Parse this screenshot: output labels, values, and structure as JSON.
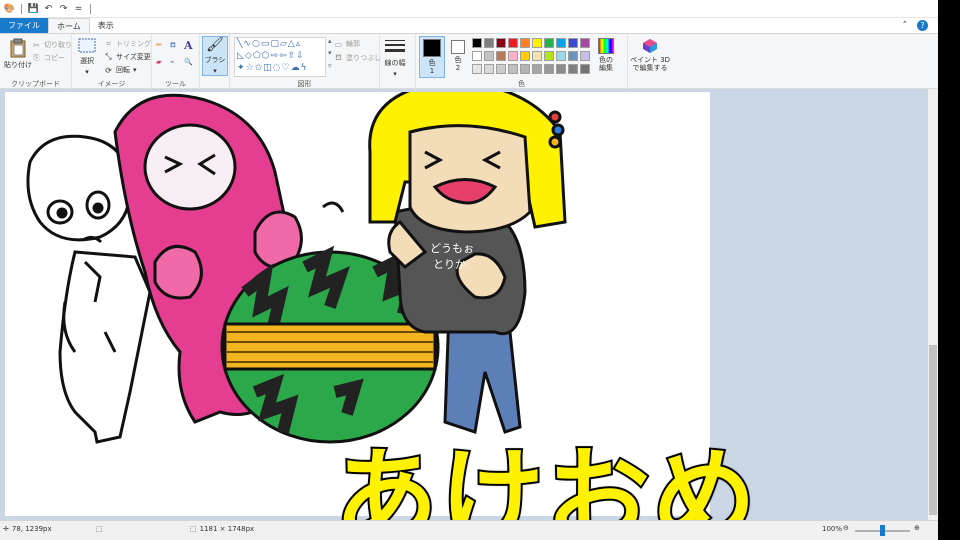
{
  "tabs": {
    "file": "ファイル",
    "home": "ホーム",
    "view": "表示"
  },
  "clipboard": {
    "paste": "貼り付け",
    "cut": "切り取り",
    "copy": "コピー",
    "label": "クリップボード"
  },
  "image": {
    "select": "選択",
    "crop": "トリミング",
    "resize": "サイズ変更",
    "rotate": "回転",
    "label": "イメージ"
  },
  "tools": {
    "label": "ツール"
  },
  "brush": {
    "label": "ブラシ"
  },
  "shapes": {
    "outline": "輪郭",
    "fill": "塗りつぶし",
    "label": "図形"
  },
  "size": {
    "label": "線の幅"
  },
  "colors": {
    "color1": "色\n1",
    "color2": "色\n2",
    "edit": "色の\n編集",
    "label": "色",
    "palette_row1": [
      "#000000",
      "#7f7f7f",
      "#880015",
      "#ed1c24",
      "#ff7f27",
      "#fff200",
      "#22b14c",
      "#00a2e8",
      "#3f48cc",
      "#a349a4"
    ],
    "palette_row2": [
      "#ffffff",
      "#c3c3c3",
      "#b97a57",
      "#ffaec9",
      "#ffc90e",
      "#efe4b0",
      "#b5e61d",
      "#99d9ea",
      "#7092be",
      "#c8bfe7"
    ],
    "palette_row3": [
      "#e6e6e6",
      "#d9d9d9",
      "#cccccc",
      "#bfbfbf",
      "#b3b3b3",
      "#a6a6a6",
      "#999999",
      "#8c8c8c",
      "#808080",
      "#737373"
    ]
  },
  "paint3d": {
    "label": "ペイント 3D\nで編集する"
  },
  "canvas_text": "あけおめ",
  "drawing_text": "どうもぉ\nとりか",
  "status": {
    "cursor": "78, 1239px",
    "size": "1181 × 1748px",
    "zoom": "100%"
  }
}
